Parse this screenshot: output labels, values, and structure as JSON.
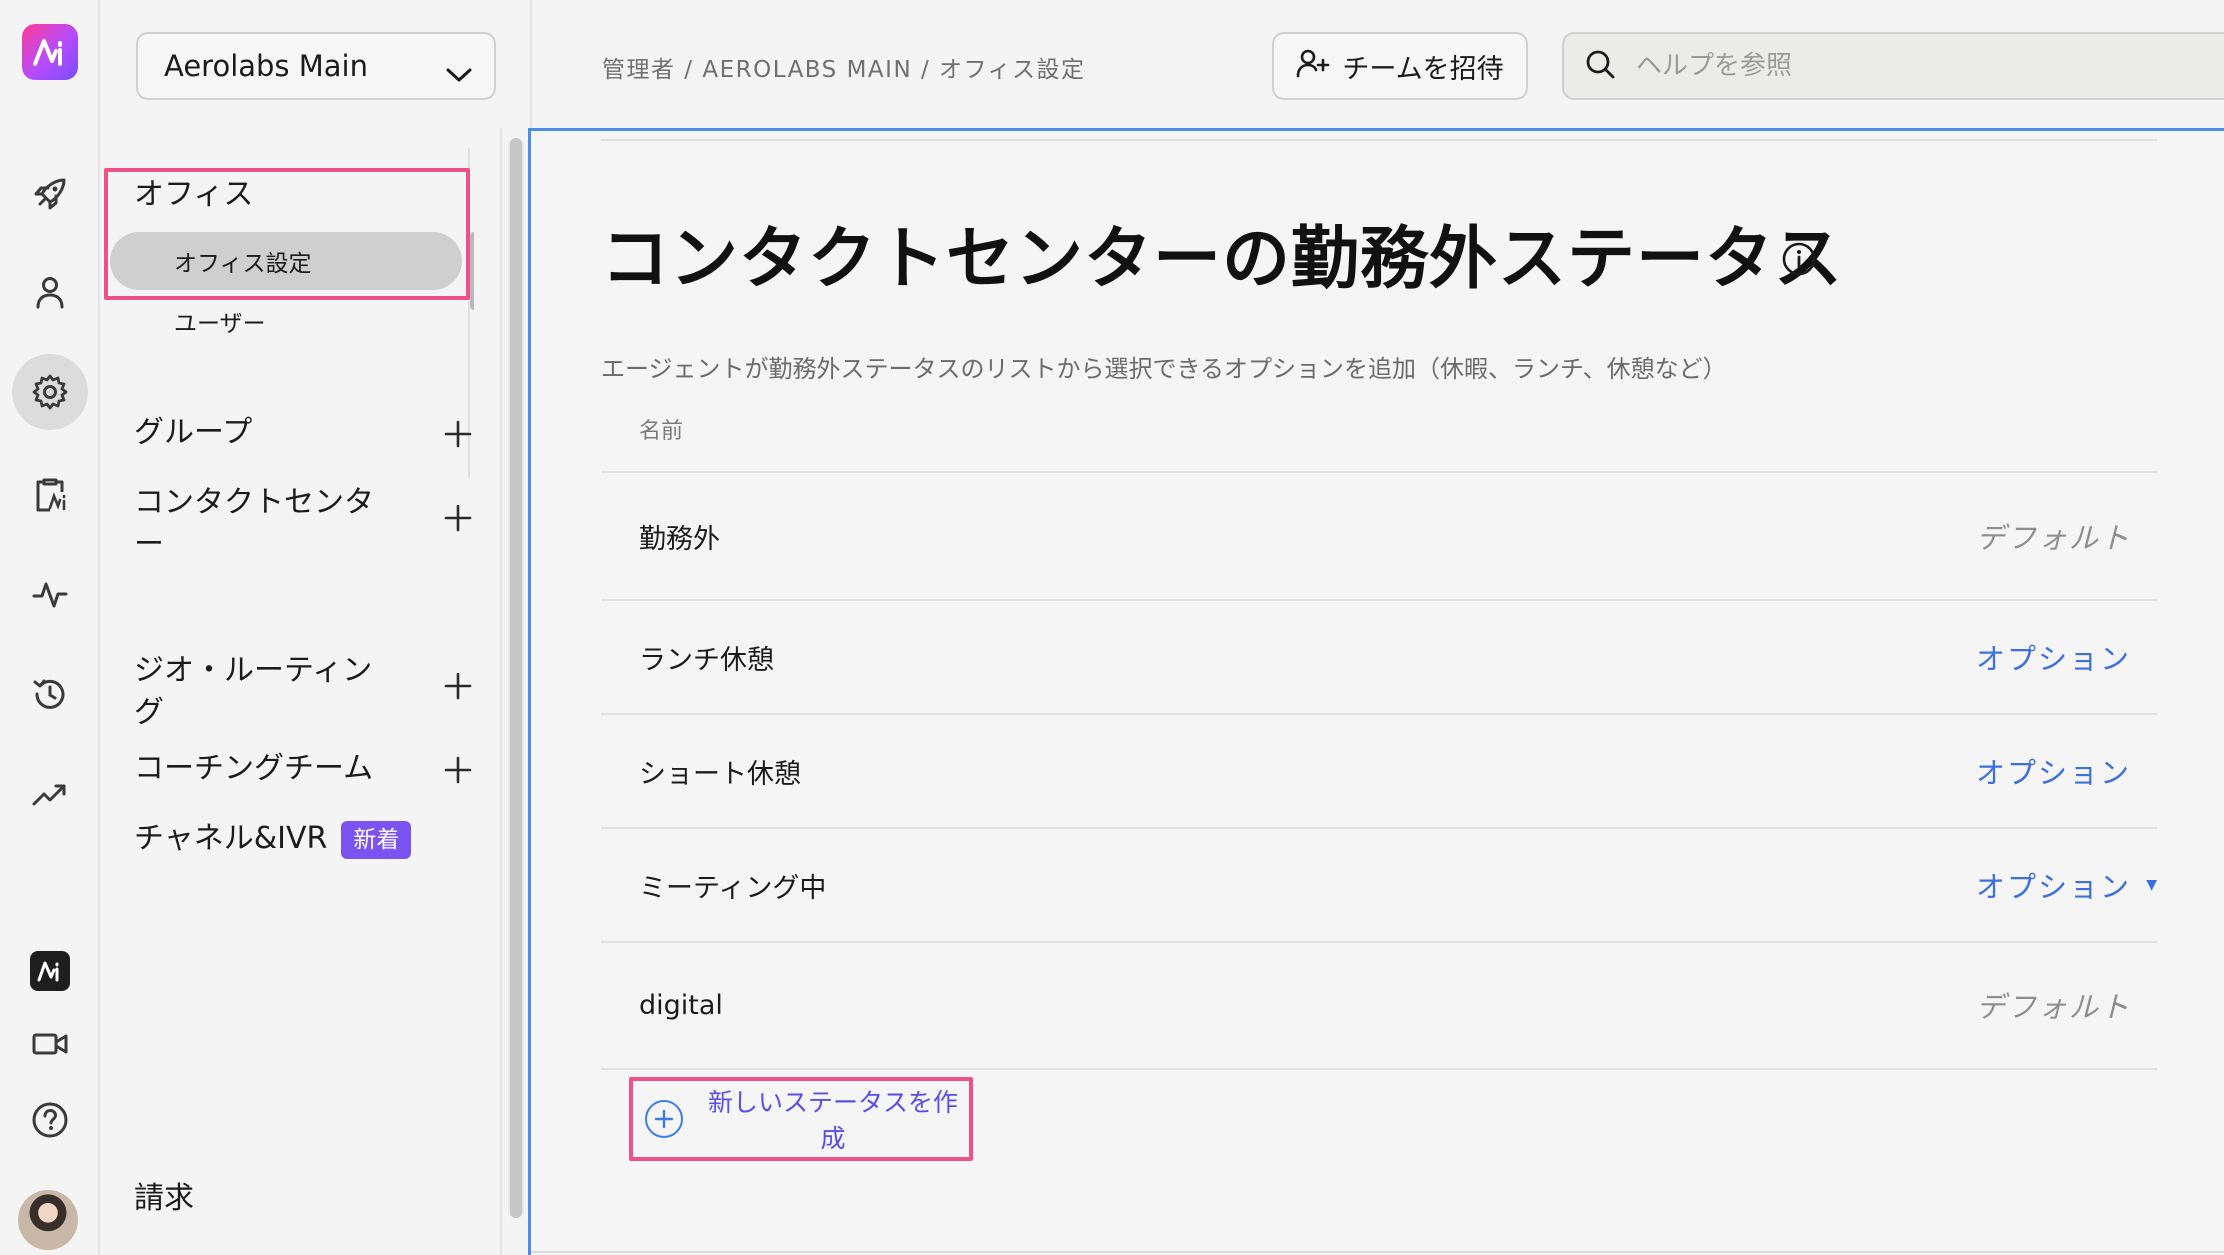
{
  "topbar": {
    "workspace": "Aerolabs Main",
    "breadcrumb": "管理者 / AEROLABS MAIN / オフィス設定",
    "invite_label": "チームを招待",
    "search_placeholder": "ヘルプを参照",
    "search_value": ""
  },
  "rail": {
    "icons": [
      "launch-icon",
      "user-icon",
      "settings-icon",
      "clipboard-icon",
      "activity-icon",
      "history-icon",
      "trending-icon",
      "brand-icon",
      "video-icon",
      "help-icon"
    ],
    "active": "settings-icon"
  },
  "sidebar": {
    "office_section": "オフィス",
    "office_settings": "オフィス設定",
    "users": "ユーザー",
    "groups": "グループ",
    "contact_center_line1": "コンタクトセンタ",
    "contact_center_line2": "ー",
    "geo_routing_line1": "ジオ・ルーティン",
    "geo_routing_line2": "グ",
    "coaching_team": "コーチングチーム",
    "channels_ivr": "チャネル&IVR",
    "channels_badge": "新着",
    "billing": "請求"
  },
  "main": {
    "title": "コンタクトセンターの勤務外ステータス",
    "description": "エージェントが勤務外ステータスのリストから選択できるオプションを追加（休暇、ランチ、休憩など）",
    "column_name": "名前",
    "rows": [
      {
        "name": "勤務外",
        "tag": "デフォルト"
      },
      {
        "name": "ランチ休憩",
        "tag": "オプション"
      },
      {
        "name": "ショート休憩",
        "tag": "オプション"
      },
      {
        "name": "ミーティング中",
        "tag": "オプション"
      },
      {
        "name": "digital",
        "tag": "デフォルト"
      }
    ],
    "create_label": "新しいステータスを作成"
  },
  "colors": {
    "accent_link": "#3d6fe0",
    "highlight": "#f0508a",
    "badge": "#7b53f0",
    "focus_border": "#4a8de8"
  }
}
